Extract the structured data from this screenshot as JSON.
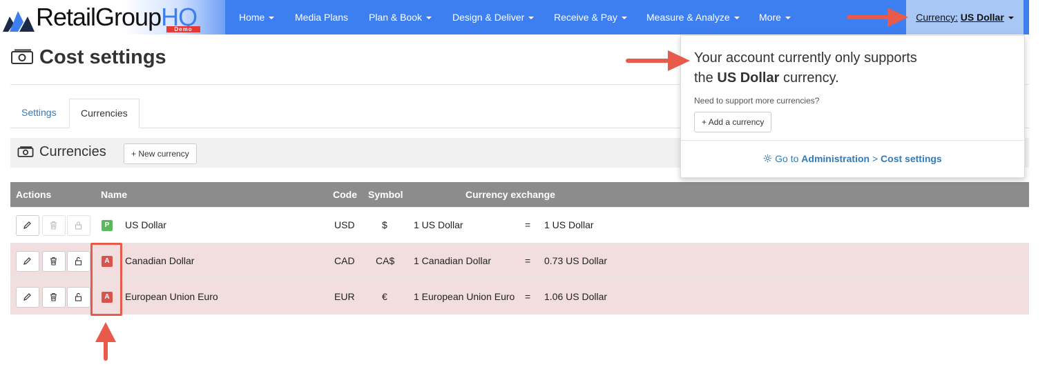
{
  "brand": {
    "name_main": "RetailGroup",
    "name_accent": "HQ",
    "badge": "Demo"
  },
  "nav": {
    "items": [
      {
        "label": "Home",
        "dropdown": true
      },
      {
        "label": "Media Plans",
        "dropdown": false
      },
      {
        "label": "Plan & Book",
        "dropdown": true
      },
      {
        "label": "Design & Deliver",
        "dropdown": true
      },
      {
        "label": "Receive & Pay",
        "dropdown": true
      },
      {
        "label": "Measure & Analyze",
        "dropdown": true
      },
      {
        "label": "More",
        "dropdown": true
      }
    ],
    "currency_label": "Currency:",
    "currency_value": "US Dollar"
  },
  "page": {
    "title": "Cost settings"
  },
  "tabs": [
    {
      "label": "Settings"
    },
    {
      "label": "Currencies"
    }
  ],
  "section": {
    "title": "Currencies",
    "new_button": "New currency"
  },
  "table": {
    "headers": {
      "actions": "Actions",
      "name": "Name",
      "code": "Code",
      "symbol": "Symbol",
      "exchange": "Currency exchange"
    },
    "rows": [
      {
        "badge": "P",
        "name": "US Dollar",
        "code": "USD",
        "symbol": "$",
        "from": "1 US Dollar",
        "eq": "=",
        "to": "1 US Dollar"
      },
      {
        "badge": "A",
        "name": "Canadian Dollar",
        "code": "CAD",
        "symbol": "CA$",
        "from": "1 Canadian Dollar",
        "eq": "=",
        "to": "0.73 US Dollar"
      },
      {
        "badge": "A",
        "name": "European Union Euro",
        "code": "EUR",
        "symbol": "€",
        "from": "1 European Union Euro",
        "eq": "=",
        "to": "1.06 US Dollar"
      }
    ]
  },
  "popover": {
    "msg_pre": "Your account currently only supports",
    "msg_the": "the",
    "msg_bold": "US Dollar",
    "msg_post": "currency.",
    "need_more": "Need to support more currencies?",
    "add_button": "Add a currency",
    "link_prefix": "Go to",
    "link_admin": "Administration",
    "link_sep": ">",
    "link_cost": "Cost settings"
  },
  "colors": {
    "nav_bg": "#3d7ff0",
    "primary_badge": "#5cb85c",
    "alert_badge": "#d9534f",
    "alert_row": "#f2dede",
    "annotation": "#e85a4a",
    "link": "#337ab7"
  }
}
